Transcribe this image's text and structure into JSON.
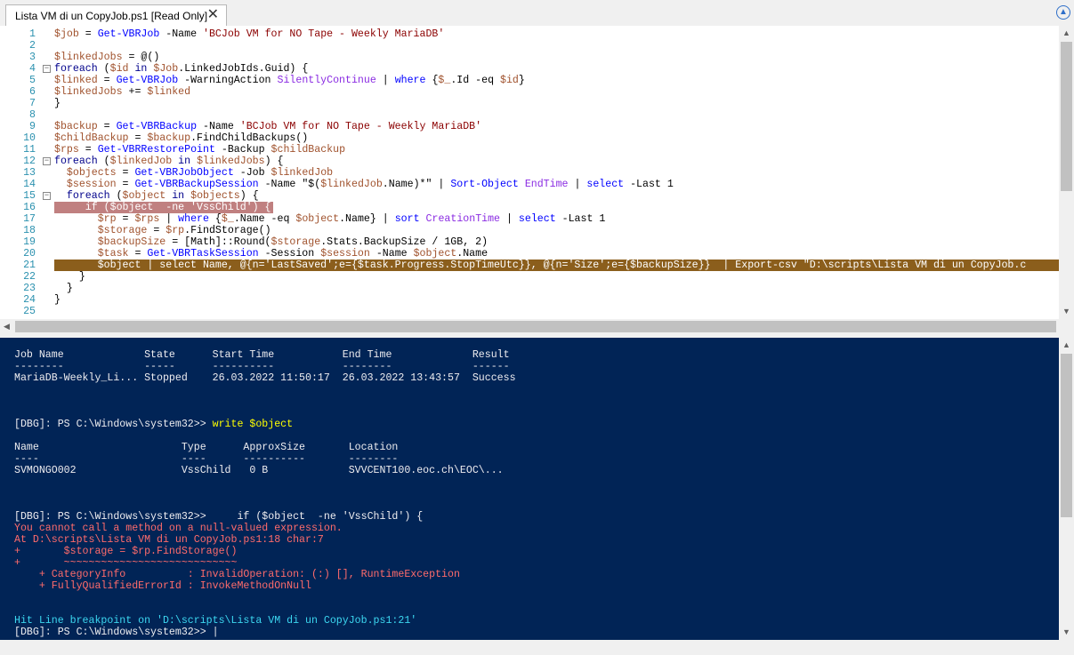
{
  "tab": {
    "title": "Lista VM di un CopyJob.ps1 [Read Only]",
    "close": "✕"
  },
  "editor": {
    "lines": [
      {
        "n": "1",
        "t": "$job = Get-VBRJob -Name 'BCJob VM for NO Tape - Weekly MariaDB'"
      },
      {
        "n": "2",
        "t": ""
      },
      {
        "n": "3",
        "t": "$linkedJobs = @()"
      },
      {
        "n": "4",
        "t": "foreach ($id in $Job.LinkedJobIds.Guid) {"
      },
      {
        "n": "5",
        "t": "$linked = Get-VBRJob -WarningAction SilentlyContinue | where {$_.Id -eq $id}"
      },
      {
        "n": "6",
        "t": "$linkedJobs += $linked"
      },
      {
        "n": "7",
        "t": "}"
      },
      {
        "n": "8",
        "t": ""
      },
      {
        "n": "9",
        "t": "$backup = Get-VBRBackup -Name 'BCJob VM for NO Tape - Weekly MariaDB'"
      },
      {
        "n": "10",
        "t": "$childBackup = $backup.FindChildBackups()"
      },
      {
        "n": "11",
        "t": "$rps = Get-VBRRestorePoint -Backup $childBackup"
      },
      {
        "n": "12",
        "t": "foreach ($linkedJob in $linkedJobs) {"
      },
      {
        "n": "13",
        "t": "  $objects = Get-VBRJobObject -Job $linkedJob"
      },
      {
        "n": "14",
        "t": "  $session = Get-VBRBackupSession -Name \"$($linkedJob.Name)*\" | Sort-Object EndTime | select -Last 1"
      },
      {
        "n": "15",
        "t": "  foreach ($object in $objects) {"
      },
      {
        "n": "16",
        "t": "     if ($object  -ne 'VssChild') {"
      },
      {
        "n": "17",
        "t": "       $rp = $rps | where {$_.Name -eq $object.Name} | sort CreationTime | select -Last 1"
      },
      {
        "n": "18",
        "t": "       $storage = $rp.FindStorage()"
      },
      {
        "n": "19",
        "t": "       $backupSize = [Math]::Round($storage.Stats.BackupSize / 1GB, 2)"
      },
      {
        "n": "20",
        "t": "       $task = Get-VBRTaskSession -Session $session -Name $object.Name"
      },
      {
        "n": "21",
        "t": "       $object | select Name, @{n='LastSaved';e={$task.Progress.StopTimeUtc}}, @{n='Size';e={$backupSize}}  | Export-csv \"D:\\scripts\\Lista VM di un CopyJob.c"
      },
      {
        "n": "22",
        "t": "    }"
      },
      {
        "n": "23",
        "t": "  }"
      },
      {
        "n": "24",
        "t": "}"
      },
      {
        "n": "25",
        "t": ""
      }
    ]
  },
  "console": {
    "lines": [
      {
        "t": "Job Name             State      Start Time           End Time             Result",
        "c": ""
      },
      {
        "t": "--------             -----      ----------           --------             ------",
        "c": ""
      },
      {
        "t": "MariaDB-Weekly_Li... Stopped    26.03.2022 11:50:17  26.03.2022 13:43:57  Success",
        "c": ""
      },
      {
        "t": "",
        "c": ""
      },
      {
        "t": "",
        "c": ""
      },
      {
        "t": "",
        "c": ""
      },
      {
        "t": "[DBG]: PS C:\\Windows\\system32>> ",
        "c": "",
        "extra": "write $object",
        "extraClass": "yel"
      },
      {
        "t": "",
        "c": ""
      },
      {
        "t": "Name                       Type      ApproxSize       Location",
        "c": ""
      },
      {
        "t": "----                       ----      ----------       --------",
        "c": ""
      },
      {
        "t": "SVMONGO002                 VssChild   0 B             SVVCENT100.eoc.ch\\EOC\\...",
        "c": ""
      },
      {
        "t": "",
        "c": ""
      },
      {
        "t": "",
        "c": ""
      },
      {
        "t": "",
        "c": ""
      },
      {
        "t": "[DBG]: PS C:\\Windows\\system32>>     if ($object  -ne 'VssChild') {",
        "c": ""
      },
      {
        "t": "You cannot call a method on a null-valued expression.",
        "c": "red"
      },
      {
        "t": "At D:\\scripts\\Lista VM di un CopyJob.ps1:18 char:7",
        "c": "red"
      },
      {
        "t": "+       $storage = $rp.FindStorage()",
        "c": "red"
      },
      {
        "t": "+       ~~~~~~~~~~~~~~~~~~~~~~~~~~~~",
        "c": "red"
      },
      {
        "t": "    + CategoryInfo          : InvalidOperation: (:) [], RuntimeException",
        "c": "red"
      },
      {
        "t": "    + FullyQualifiedErrorId : InvokeMethodOnNull",
        "c": "red"
      },
      {
        "t": "",
        "c": ""
      },
      {
        "t": "",
        "c": ""
      },
      {
        "t": "Hit Line breakpoint on 'D:\\scripts\\Lista VM di un CopyJob.ps1:21'",
        "c": "cyan"
      },
      {
        "t": "[DBG]: PS C:\\Windows\\system32>> |",
        "c": ""
      }
    ]
  }
}
